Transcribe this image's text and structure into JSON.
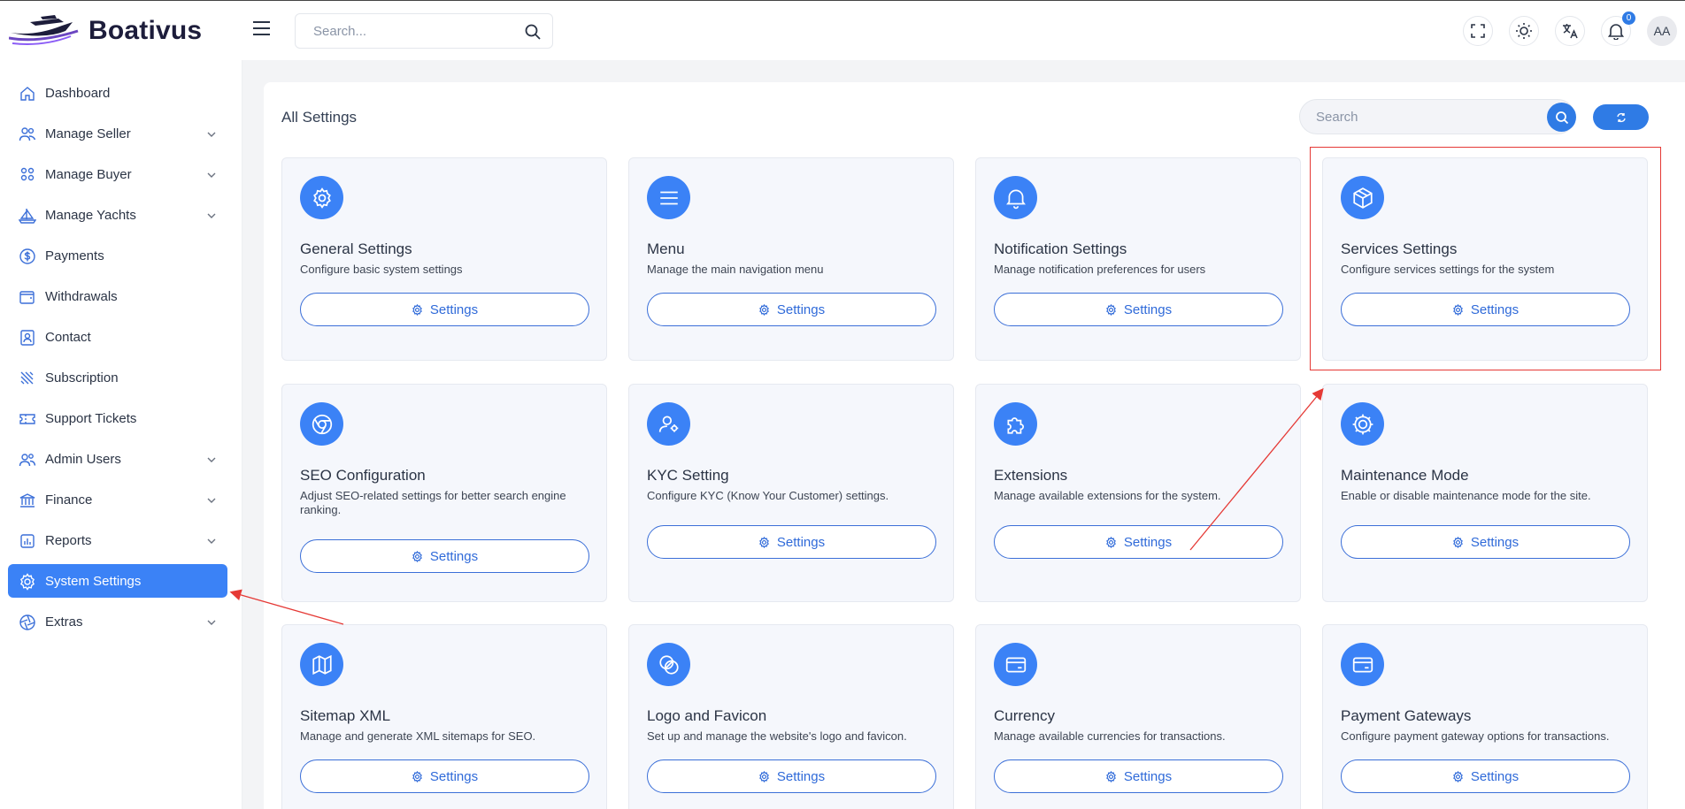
{
  "header": {
    "brand": "Boativus",
    "search_placeholder": "Search...",
    "notification_count": "0",
    "avatar_initials": "AA"
  },
  "sidebar": {
    "items": [
      {
        "label": "Dashboard",
        "icon": "home-icon",
        "has_submenu": false
      },
      {
        "label": "Manage Seller",
        "icon": "users-icon",
        "has_submenu": true
      },
      {
        "label": "Manage Buyer",
        "icon": "group-icon",
        "has_submenu": true
      },
      {
        "label": "Manage Yachts",
        "icon": "sailboat-icon",
        "has_submenu": true
      },
      {
        "label": "Payments",
        "icon": "dollar-circle-icon",
        "has_submenu": false
      },
      {
        "label": "Withdrawals",
        "icon": "wallet-icon",
        "has_submenu": false
      },
      {
        "label": "Contact",
        "icon": "contact-card-icon",
        "has_submenu": false
      },
      {
        "label": "Subscription",
        "icon": "subscription-icon",
        "has_submenu": false
      },
      {
        "label": "Support Tickets",
        "icon": "ticket-icon",
        "has_submenu": false
      },
      {
        "label": "Admin Users",
        "icon": "admin-users-icon",
        "has_submenu": true
      },
      {
        "label": "Finance",
        "icon": "bank-icon",
        "has_submenu": true
      },
      {
        "label": "Reports",
        "icon": "report-icon",
        "has_submenu": true
      },
      {
        "label": "System Settings",
        "icon": "gear-icon",
        "has_submenu": false,
        "active": true
      },
      {
        "label": "Extras",
        "icon": "aperture-icon",
        "has_submenu": true
      }
    ]
  },
  "main": {
    "title": "All Settings",
    "search_placeholder": "Search",
    "cards": [
      {
        "title": "General Settings",
        "description": "Configure basic system settings",
        "button": "Settings",
        "icon": "gear-icon"
      },
      {
        "title": "Menu",
        "description": "Manage the main navigation menu",
        "button": "Settings",
        "icon": "menu-lines-icon"
      },
      {
        "title": "Notification Settings",
        "description": "Manage notification preferences for users",
        "button": "Settings",
        "icon": "bell-icon"
      },
      {
        "title": "Services Settings",
        "description": "Configure services settings for the system",
        "button": "Settings",
        "icon": "box-icon"
      },
      {
        "title": "SEO Configuration",
        "description": "Adjust SEO-related settings for better search engine ranking.",
        "button": "Settings",
        "icon": "chrome-icon"
      },
      {
        "title": "KYC Setting",
        "description": "Configure KYC (Know Your Customer) settings.",
        "button": "Settings",
        "icon": "user-gear-icon"
      },
      {
        "title": "Extensions",
        "description": "Manage available extensions for the system.",
        "button": "Settings",
        "icon": "puzzle-icon"
      },
      {
        "title": "Maintenance Mode",
        "description": "Enable or disable maintenance mode for the site.",
        "button": "Settings",
        "icon": "cog-wheel-icon"
      },
      {
        "title": "Sitemap XML",
        "description": "Manage and generate XML sitemaps for SEO.",
        "button": "Settings",
        "icon": "map-icon"
      },
      {
        "title": "Logo and Favicon",
        "description": "Set up and manage the website's logo and favicon.",
        "button": "Settings",
        "icon": "logo-swirl-icon"
      },
      {
        "title": "Currency",
        "description": "Manage available currencies for transactions.",
        "button": "Settings",
        "icon": "card-icon"
      },
      {
        "title": "Payment Gateways",
        "description": "Configure payment gateway options for transactions.",
        "button": "Settings",
        "icon": "card-icon"
      }
    ]
  },
  "colors": {
    "accent": "#3b82f6",
    "button_border": "#3b6fd8",
    "annotation": "#e53935"
  }
}
